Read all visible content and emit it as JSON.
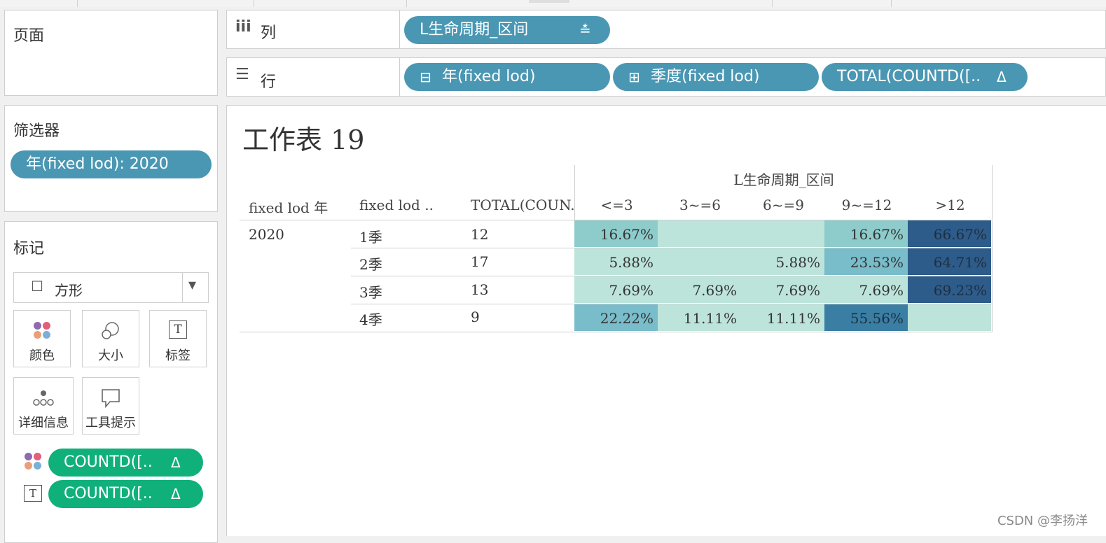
{
  "pages_panel": {
    "title": "页面"
  },
  "filters_panel": {
    "title": "筛选器",
    "filter_pill": "年(fixed lod): 2020"
  },
  "marks_panel": {
    "title": "标记",
    "mark_type": {
      "glyph": "☐",
      "label": "方形",
      "dropdown_glyph": "▾"
    },
    "buttons": {
      "color": "颜色",
      "size": "大小",
      "label": "标签",
      "detail": "详细信息",
      "tooltip": "工具提示"
    },
    "label_icon_glyph": "T",
    "fields": [
      {
        "role": "color",
        "text": "COUNTD([..",
        "delta": "Δ"
      },
      {
        "role": "label",
        "text": "COUNTD([..",
        "delta": "Δ"
      }
    ]
  },
  "columns_shelf": {
    "icon": "iii",
    "label": "列",
    "pills": [
      {
        "text": "L生命周期_区间",
        "sort_glyph": "≛"
      }
    ]
  },
  "rows_shelf": {
    "icon": "☰",
    "label": "行",
    "pills": [
      {
        "glyph": "⊟",
        "text": "年(fixed lod)"
      },
      {
        "glyph": "⊞",
        "text": "季度(fixed lod)"
      },
      {
        "text": "TOTAL(COUNTD([..",
        "delta": "Δ"
      }
    ]
  },
  "sheet": {
    "title": "工作表 19",
    "column_group_header": "L生命周期_区间",
    "row_headers": [
      "fixed lod 年",
      "fixed lod ..",
      "TOTAL(COUN.."
    ],
    "column_headers": [
      "<=3",
      "3~=6",
      "6~=9",
      "9~=12",
      ">12"
    ],
    "rows": [
      {
        "year": "2020",
        "quarter": "1季",
        "total": "12",
        "cells": [
          "16.67%",
          "",
          "",
          "16.67%",
          "66.67%"
        ],
        "levels": [
          2,
          1,
          1,
          2,
          5
        ]
      },
      {
        "year": "",
        "quarter": "2季",
        "total": "17",
        "cells": [
          "5.88%",
          "",
          "5.88%",
          "23.53%",
          "64.71%"
        ],
        "levels": [
          1,
          1,
          1,
          3,
          5
        ]
      },
      {
        "year": "",
        "quarter": "3季",
        "total": "13",
        "cells": [
          "7.69%",
          "7.69%",
          "7.69%",
          "7.69%",
          "69.23%"
        ],
        "levels": [
          1,
          1,
          1,
          1,
          5
        ]
      },
      {
        "year": "",
        "quarter": "4季",
        "total": "9",
        "cells": [
          "22.22%",
          "11.11%",
          "11.11%",
          "55.56%",
          ""
        ],
        "levels": [
          3,
          1,
          1,
          4,
          1
        ]
      }
    ],
    "palette": [
      "#bde4db",
      "#8ecccc",
      "#79bcca",
      "#3a7ea4",
      "#2d5b8a"
    ]
  },
  "watermark": "CSDN @李扬洋"
}
